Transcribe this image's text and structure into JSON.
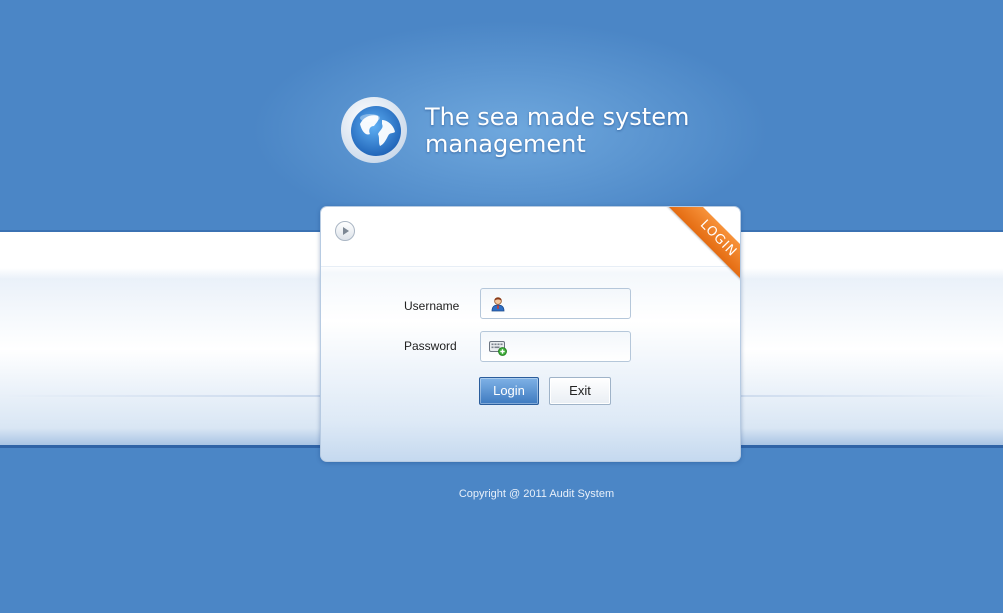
{
  "header": {
    "title_line1": "The sea made system",
    "title_line2": "management",
    "logo_icon": "globe-icon"
  },
  "login_panel": {
    "ribbon_label": "LOGIN",
    "expand_icon": "play-icon",
    "username_label": "Username",
    "username_value": "",
    "username_icon": "user-icon",
    "password_label": "Password",
    "password_value": "",
    "password_icon": "keyboard-icon",
    "login_button": "Login",
    "exit_button": "Exit"
  },
  "footer": {
    "copyright": "Copyright @ 2011  Audit System"
  },
  "colors": {
    "background": "#4b86c6",
    "ribbon": "#ef7f25",
    "login_button": "#4a86c8"
  }
}
